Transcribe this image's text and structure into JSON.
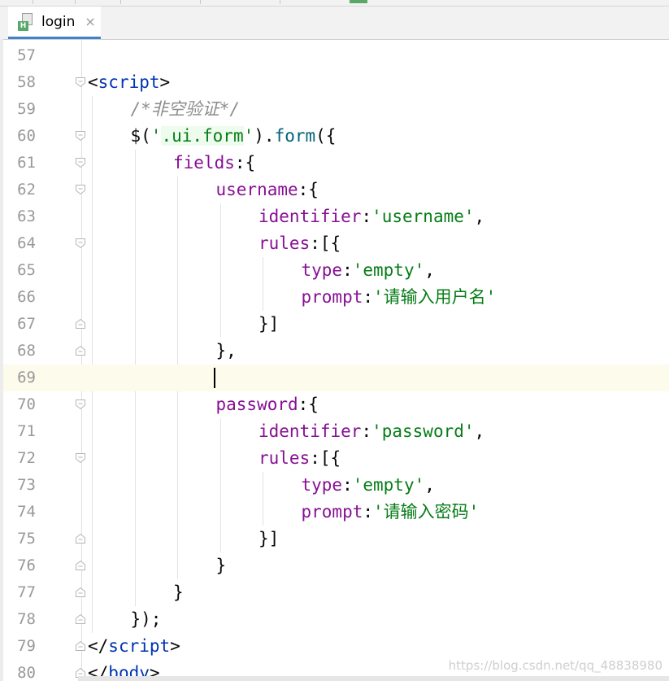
{
  "tab": {
    "label": "login",
    "close": "×",
    "file_badge": "H"
  },
  "lines": [
    {
      "num": "57",
      "indent": 0,
      "fold": "",
      "tokens": []
    },
    {
      "num": "58",
      "indent": 0,
      "fold": "open",
      "tokens": [
        [
          "p",
          "<"
        ],
        [
          "tag",
          "script"
        ],
        [
          "p",
          ">"
        ]
      ]
    },
    {
      "num": "59",
      "indent": 1,
      "fold": "",
      "tokens": [
        [
          "cmt",
          "/*非空验证*/"
        ]
      ]
    },
    {
      "num": "60",
      "indent": 1,
      "fold": "open",
      "tokens": [
        [
          "p",
          "$("
        ],
        [
          "str",
          "'"
        ],
        [
          "strhl",
          ".ui.form"
        ],
        [
          "str",
          "'"
        ],
        [
          "p",
          ")."
        ],
        [
          "fn",
          "form"
        ],
        [
          "p",
          "({"
        ]
      ]
    },
    {
      "num": "61",
      "indent": 2,
      "fold": "open",
      "tokens": [
        [
          "prop",
          "fields"
        ],
        [
          "p",
          ":{"
        ]
      ]
    },
    {
      "num": "62",
      "indent": 3,
      "fold": "open",
      "tokens": [
        [
          "prop",
          "username"
        ],
        [
          "p",
          ":{"
        ]
      ]
    },
    {
      "num": "63",
      "indent": 4,
      "fold": "",
      "tokens": [
        [
          "prop",
          "identifier"
        ],
        [
          "p",
          ":"
        ],
        [
          "str",
          "'username'"
        ],
        [
          "p",
          ","
        ]
      ]
    },
    {
      "num": "64",
      "indent": 4,
      "fold": "open",
      "tokens": [
        [
          "prop",
          "rules"
        ],
        [
          "p",
          ":[{"
        ]
      ]
    },
    {
      "num": "65",
      "indent": 5,
      "fold": "",
      "tokens": [
        [
          "prop",
          "type"
        ],
        [
          "p",
          ":"
        ],
        [
          "str",
          "'empty'"
        ],
        [
          "p",
          ","
        ]
      ]
    },
    {
      "num": "66",
      "indent": 5,
      "fold": "",
      "tokens": [
        [
          "prop",
          "prompt"
        ],
        [
          "p",
          ":"
        ],
        [
          "str",
          "'请输入用户名'"
        ]
      ]
    },
    {
      "num": "67",
      "indent": 4,
      "fold": "close",
      "tokens": [
        [
          "p",
          "}]"
        ]
      ]
    },
    {
      "num": "68",
      "indent": 3,
      "fold": "close",
      "tokens": [
        [
          "p",
          "},"
        ]
      ]
    },
    {
      "num": "69",
      "indent": 0,
      "fold": "",
      "tokens": [],
      "current": true
    },
    {
      "num": "70",
      "indent": 3,
      "fold": "open",
      "tokens": [
        [
          "prop",
          "password"
        ],
        [
          "p",
          ":{"
        ]
      ]
    },
    {
      "num": "71",
      "indent": 4,
      "fold": "",
      "tokens": [
        [
          "prop",
          "identifier"
        ],
        [
          "p",
          ":"
        ],
        [
          "str",
          "'password'"
        ],
        [
          "p",
          ","
        ]
      ]
    },
    {
      "num": "72",
      "indent": 4,
      "fold": "open",
      "tokens": [
        [
          "prop",
          "rules"
        ],
        [
          "p",
          ":[{"
        ]
      ]
    },
    {
      "num": "73",
      "indent": 5,
      "fold": "",
      "tokens": [
        [
          "prop",
          "type"
        ],
        [
          "p",
          ":"
        ],
        [
          "str",
          "'empty'"
        ],
        [
          "p",
          ","
        ]
      ]
    },
    {
      "num": "74",
      "indent": 5,
      "fold": "",
      "tokens": [
        [
          "prop",
          "prompt"
        ],
        [
          "p",
          ":"
        ],
        [
          "str",
          "'请输入密码'"
        ]
      ]
    },
    {
      "num": "75",
      "indent": 4,
      "fold": "close",
      "tokens": [
        [
          "p",
          "}]"
        ]
      ]
    },
    {
      "num": "76",
      "indent": 3,
      "fold": "close",
      "tokens": [
        [
          "p",
          "}"
        ]
      ]
    },
    {
      "num": "77",
      "indent": 2,
      "fold": "close",
      "tokens": [
        [
          "p",
          "}"
        ]
      ]
    },
    {
      "num": "78",
      "indent": 1,
      "fold": "close",
      "tokens": [
        [
          "p",
          "});"
        ]
      ]
    },
    {
      "num": "79",
      "indent": 0,
      "fold": "close",
      "tokens": [
        [
          "p",
          "</"
        ],
        [
          "tag",
          "script"
        ],
        [
          "p",
          ">"
        ]
      ]
    },
    {
      "num": "80",
      "indent": 0,
      "fold": "close",
      "tokens": [
        [
          "p",
          "</"
        ],
        [
          "tag",
          "body"
        ],
        [
          "p",
          ">"
        ]
      ]
    }
  ],
  "watermark": "https://blog.csdn.net/qq_48838980",
  "colors": {
    "tag": "#0033b3",
    "property": "#871094",
    "string": "#067d17",
    "function": "#00627a",
    "comment": "#8c8c8c",
    "current_line": "#fdfbeb",
    "tab_accent": "#4083c9"
  }
}
